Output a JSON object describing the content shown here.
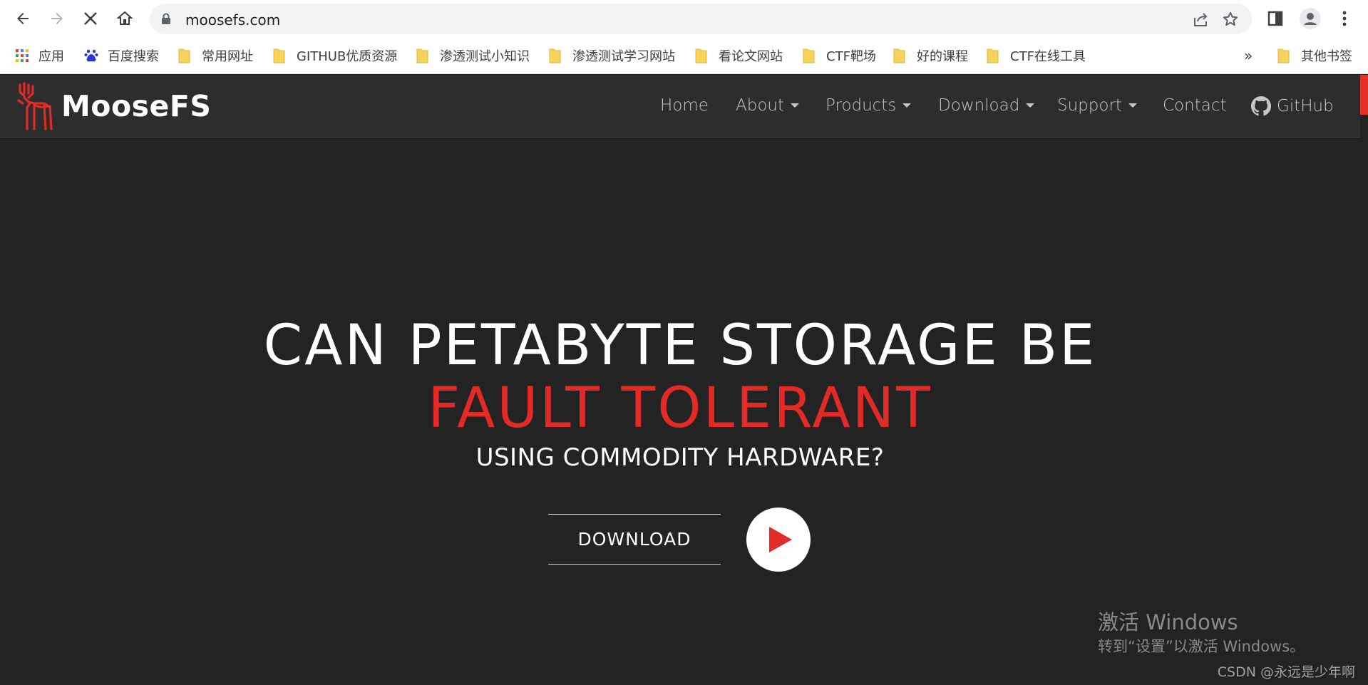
{
  "browser": {
    "url": "moosefs.com",
    "icons": [
      "back-arrow-icon",
      "forward-arrow-icon",
      "stop-loading-icon",
      "home-icon",
      "lock-icon",
      "share-icon",
      "bookmark-star-icon",
      "side-panel-icon",
      "profile-icon",
      "kebab-menu-icon"
    ]
  },
  "bookmarks": {
    "items": [
      {
        "label": "应用",
        "icon": "apps-grid-icon"
      },
      {
        "label": "百度搜索",
        "icon": "baidu-paw-icon"
      },
      {
        "label": "常用网址",
        "icon": "folder-icon"
      },
      {
        "label": "GITHUB优质资源",
        "icon": "folder-icon"
      },
      {
        "label": "渗透测试小知识",
        "icon": "folder-icon"
      },
      {
        "label": "渗透测试学习网站",
        "icon": "folder-icon"
      },
      {
        "label": "看论文网站",
        "icon": "folder-icon"
      },
      {
        "label": "CTF靶场",
        "icon": "folder-icon"
      },
      {
        "label": "好的课程",
        "icon": "folder-icon"
      },
      {
        "label": "CTF在线工具",
        "icon": "folder-icon"
      }
    ],
    "overflow": "»",
    "other": "其他书签",
    "folder_color": "#f7d35c"
  },
  "site": {
    "logo_text": "MooseFS",
    "nav": {
      "home": "Home",
      "about": "About",
      "products": "Products",
      "download": "Download",
      "support": "Support",
      "contact": "Contact",
      "github": "GitHub"
    },
    "hero": {
      "line1": "CAN PETABYTE STORAGE BE",
      "line2": "FAULT TOLERANT",
      "line3": "USING COMMODITY HARDWARE?",
      "download_button": "DOWNLOAD"
    },
    "accent_color": "#e32a27"
  },
  "watermarks": {
    "windows_title": "激活 Windows",
    "windows_sub": "转到“设置”以激活 Windows。",
    "csdn": "CSDN @永远是少年啊"
  }
}
